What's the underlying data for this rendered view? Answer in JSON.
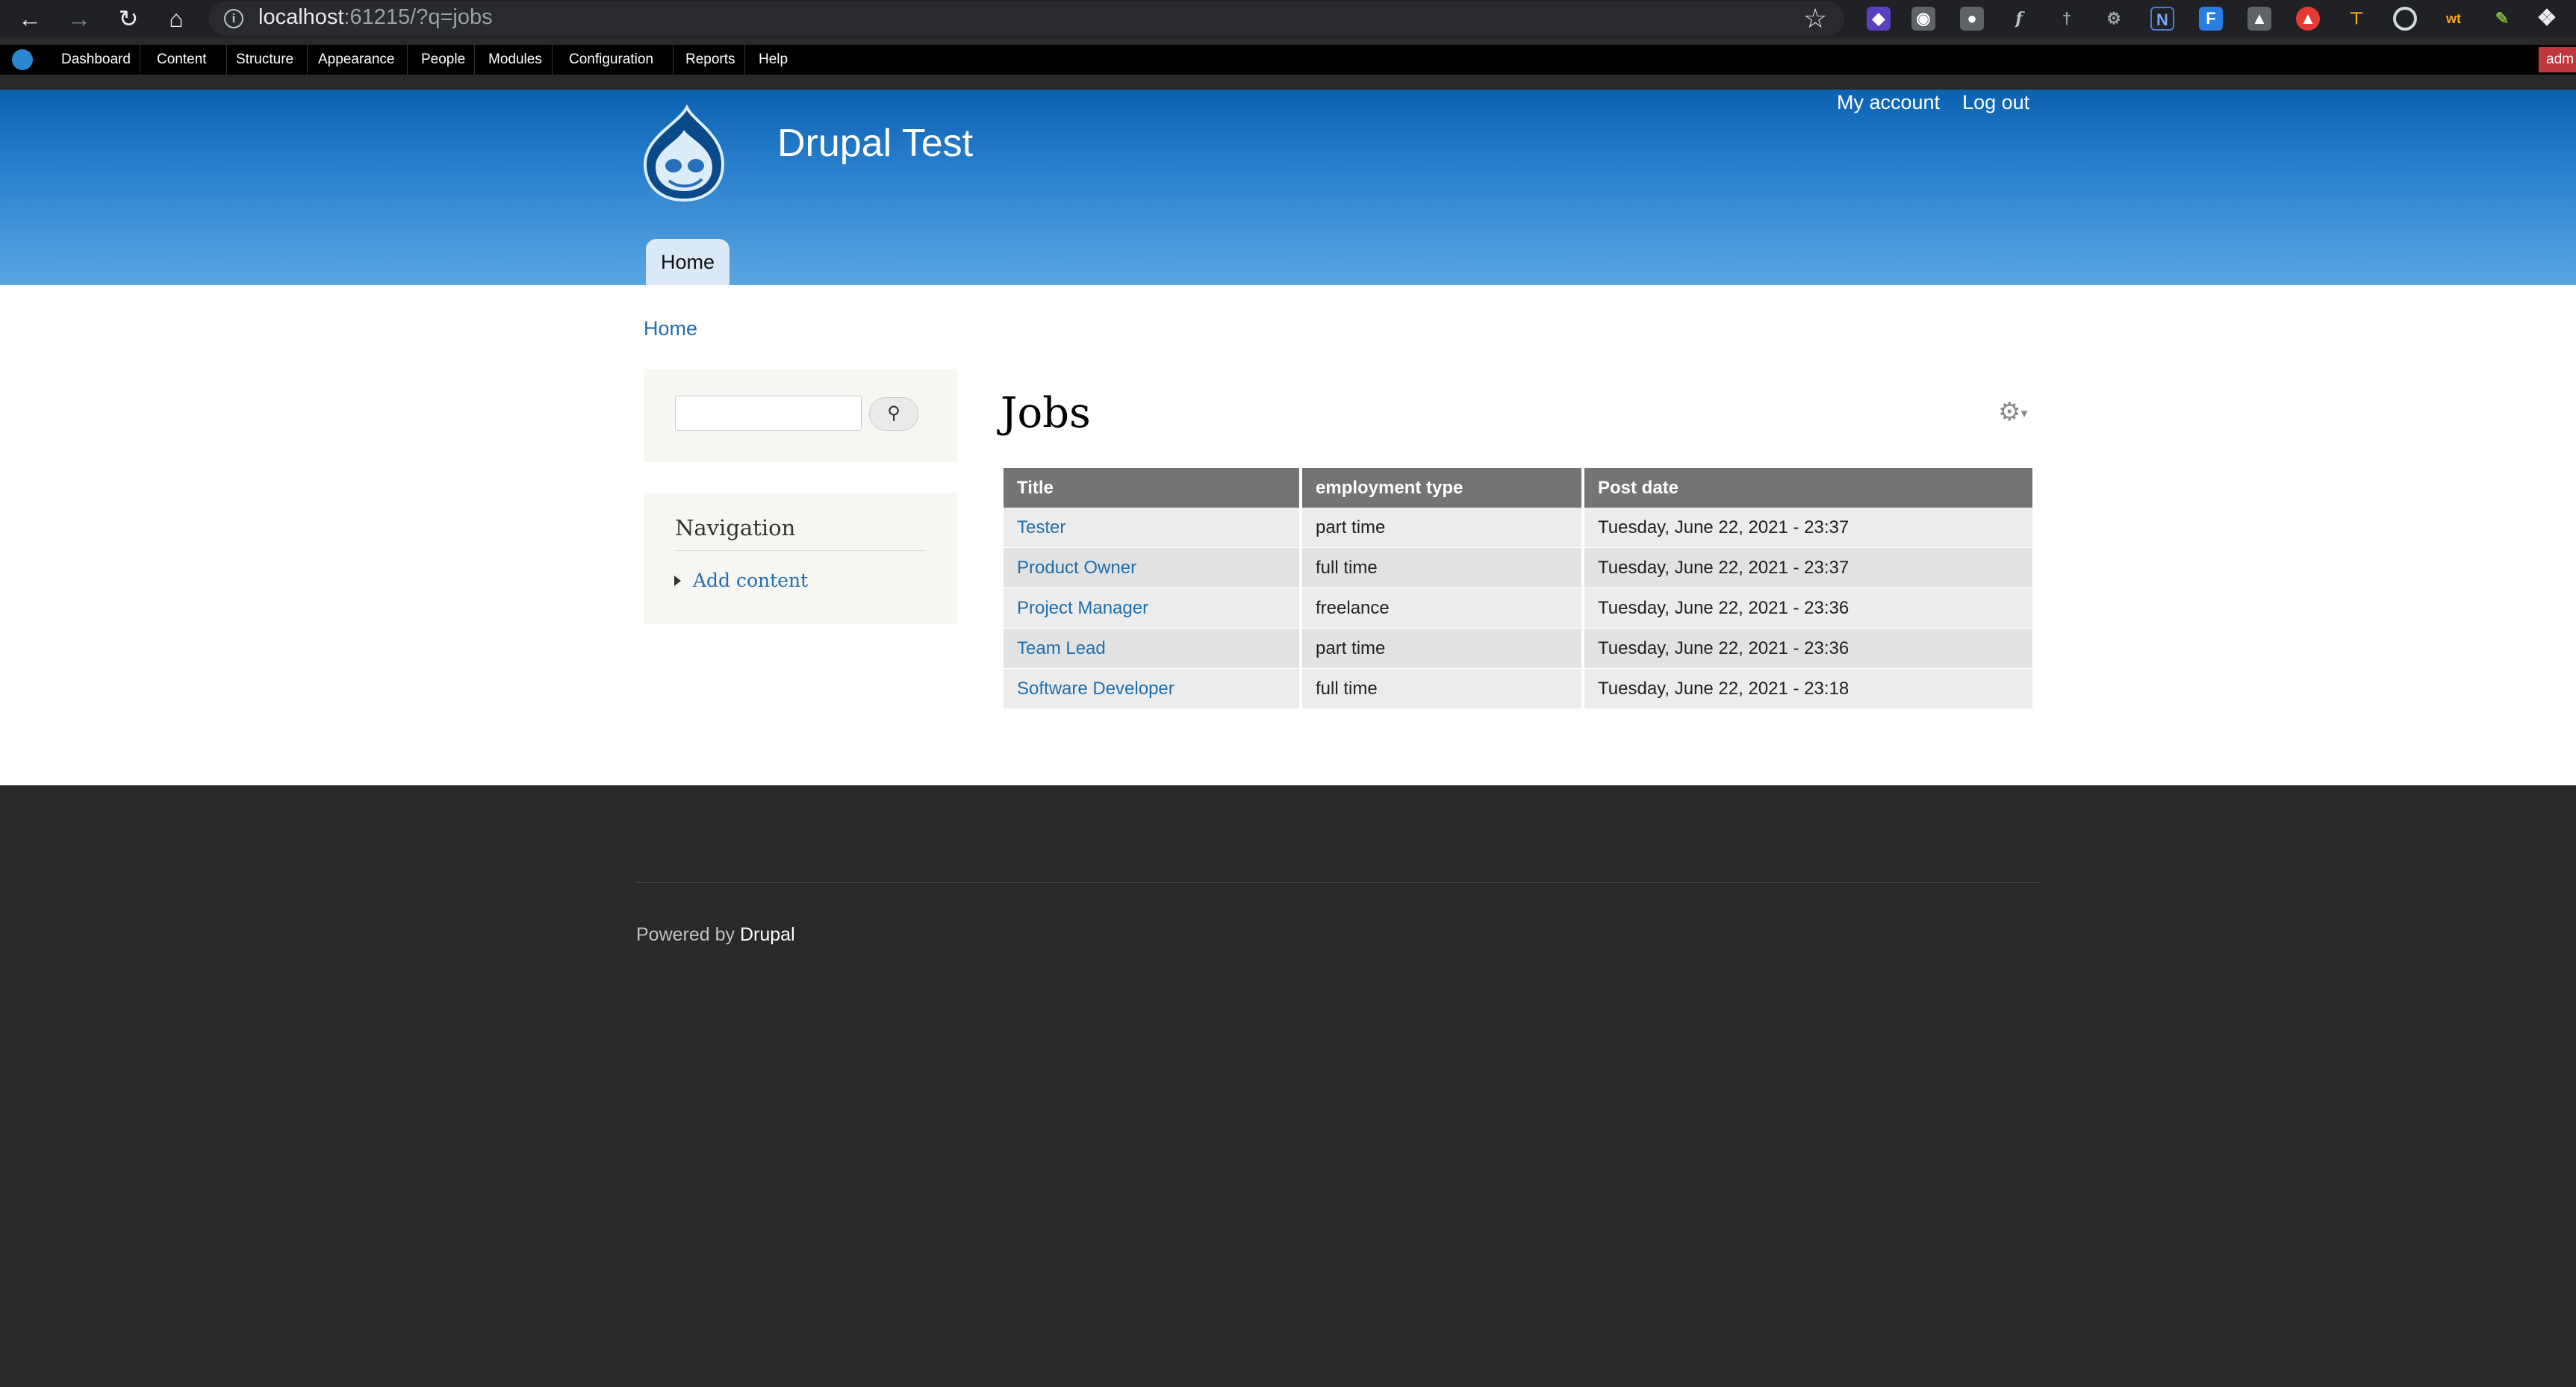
{
  "browser": {
    "url_host": "localhost",
    "url_rest": ":61215/?q=jobs"
  },
  "toolbar": {
    "items": [
      "Dashboard",
      "Content",
      "Structure",
      "Appearance",
      "People",
      "Modules",
      "Configuration",
      "Reports",
      "Help"
    ],
    "user_label": "adm"
  },
  "header": {
    "site_name": "Drupal Test",
    "secondary_menu": [
      "My account",
      "Log out"
    ],
    "main_tab": "Home"
  },
  "breadcrumb": "Home",
  "sidebar": {
    "search_placeholder": "",
    "navigation_title": "Navigation",
    "navigation_link": "Add content"
  },
  "main": {
    "title": "Jobs",
    "columns": [
      "Title",
      "employment type",
      "Post date"
    ],
    "rows": [
      {
        "title": "Tester",
        "type": "part time",
        "date": "Tuesday, June 22, 2021 - 23:37"
      },
      {
        "title": "Product Owner",
        "type": "full time",
        "date": "Tuesday, June 22, 2021 - 23:37"
      },
      {
        "title": "Project Manager",
        "type": "freelance",
        "date": "Tuesday, June 22, 2021 - 23:36"
      },
      {
        "title": "Team Lead",
        "type": "part time",
        "date": "Tuesday, June 22, 2021 - 23:36"
      },
      {
        "title": "Software Developer",
        "type": "full time",
        "date": "Tuesday, June 22, 2021 - 23:18"
      }
    ]
  },
  "footer": {
    "prefix": "Powered by",
    "link": "Drupal"
  },
  "colors": {
    "header_top": "#0a61b0",
    "header_bottom": "#5ba5e1",
    "link": "#1f6ead",
    "footer_bg": "#292929"
  }
}
